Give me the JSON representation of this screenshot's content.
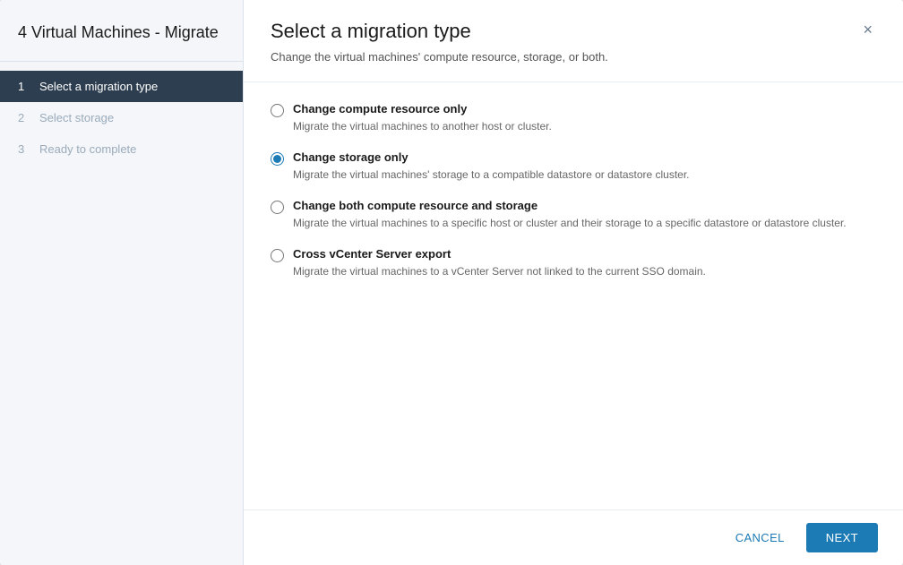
{
  "sidebar": {
    "title": "4 Virtual Machines - Migrate",
    "steps": [
      {
        "num": "1",
        "label": "Select a migration type",
        "state": "active"
      },
      {
        "num": "2",
        "label": "Select storage",
        "state": "disabled"
      },
      {
        "num": "3",
        "label": "Ready to complete",
        "state": "disabled"
      }
    ]
  },
  "main": {
    "title": "Select a migration type",
    "subtitle": "Change the virtual machines' compute resource, storage, or both.",
    "close_label": "×",
    "options": [
      {
        "id": "opt1",
        "label": "Change compute resource only",
        "desc": "Migrate the virtual machines to another host or cluster.",
        "checked": false
      },
      {
        "id": "opt2",
        "label": "Change storage only",
        "desc": "Migrate the virtual machines' storage to a compatible datastore or datastore cluster.",
        "checked": true
      },
      {
        "id": "opt3",
        "label": "Change both compute resource and storage",
        "desc": "Migrate the virtual machines to a specific host or cluster and their storage to a specific datastore or datastore cluster.",
        "checked": false
      },
      {
        "id": "opt4",
        "label": "Cross vCenter Server export",
        "desc": "Migrate the virtual machines to a vCenter Server not linked to the current SSO domain.",
        "checked": false
      }
    ]
  },
  "footer": {
    "cancel_label": "CANCEL",
    "next_label": "NEXT"
  }
}
